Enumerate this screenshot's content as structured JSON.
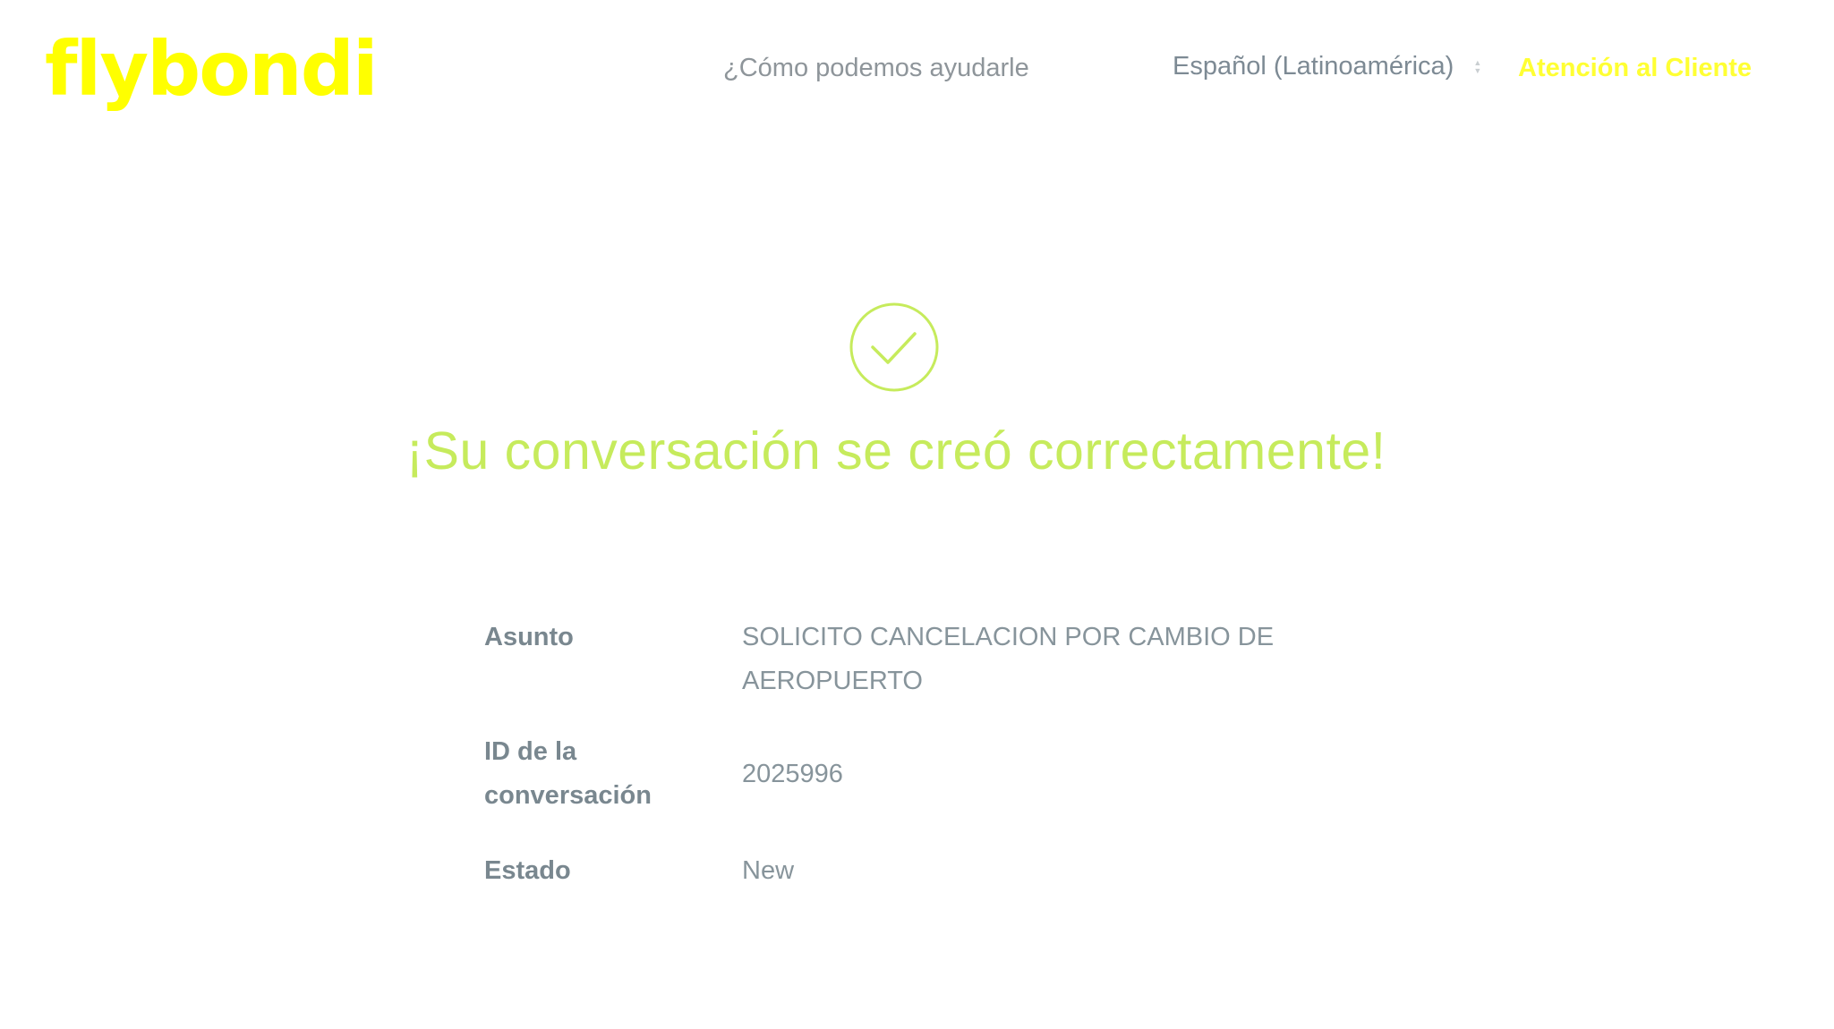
{
  "header": {
    "logo_text": "flybondi",
    "help_link": "¿Cómo podemos ayudarle",
    "language": "Español (Latinoamérica)",
    "support_link": "Atención al Cliente"
  },
  "success": {
    "icon": "check-circle-icon",
    "title": "¡Su conversación se creó correctamente!"
  },
  "details": {
    "subject_label": "Asunto",
    "subject_value": "SOLICITO CANCELACION POR CAMBIO DE AEROPUERTO",
    "id_label": "ID de la conversación",
    "id_value": "2025996",
    "status_label": "Estado",
    "status_value": "New"
  },
  "colors": {
    "logo": "#ffff00",
    "support_link": "#ffff33",
    "success_green": "#c6eb5c",
    "label_gray": "#79878f",
    "value_gray": "#87949b"
  }
}
